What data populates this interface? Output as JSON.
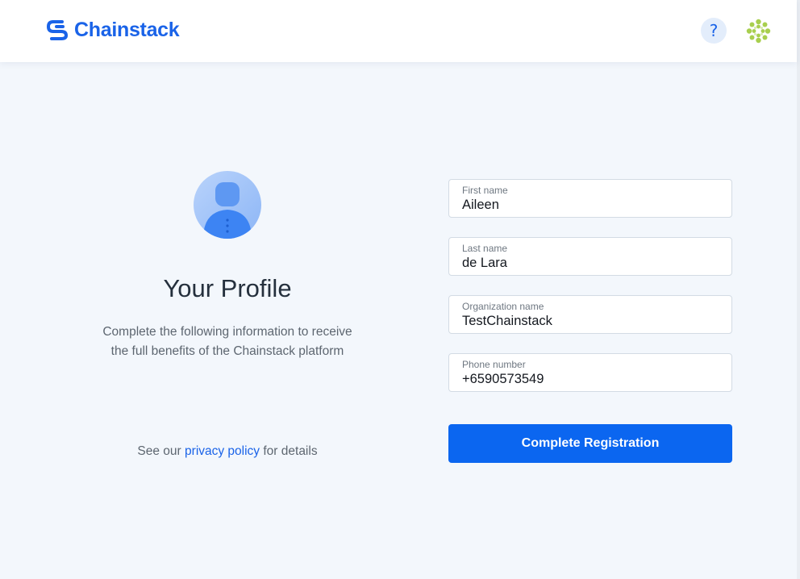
{
  "header": {
    "brand": "Chainstack",
    "help_label": "?",
    "colors": {
      "brand": "#1a63e8",
      "help_bg": "#e3edfb"
    },
    "icons": {
      "logo": "chainstack-logo-icon",
      "help": "help-icon",
      "user": "user-identicon"
    }
  },
  "profile": {
    "title": "Your Profile",
    "description": "Complete the following information to receive the full benefits of the Chainstack platform",
    "avatar_icon": "user-placeholder-icon",
    "privacy": {
      "prefix": "See our",
      "link_text": "privacy policy",
      "suffix": "for details"
    }
  },
  "form": {
    "first_name": {
      "label": "First name",
      "value": "Aileen"
    },
    "last_name": {
      "label": "Last name",
      "value": "de Lara"
    },
    "organization": {
      "label": "Organization name",
      "value": "TestChainstack"
    },
    "phone": {
      "label": "Phone number",
      "value": "+6590573549"
    },
    "submit_label": "Complete Registration",
    "colors": {
      "button": "#0b66f0",
      "background": "#f3f7fc"
    }
  }
}
